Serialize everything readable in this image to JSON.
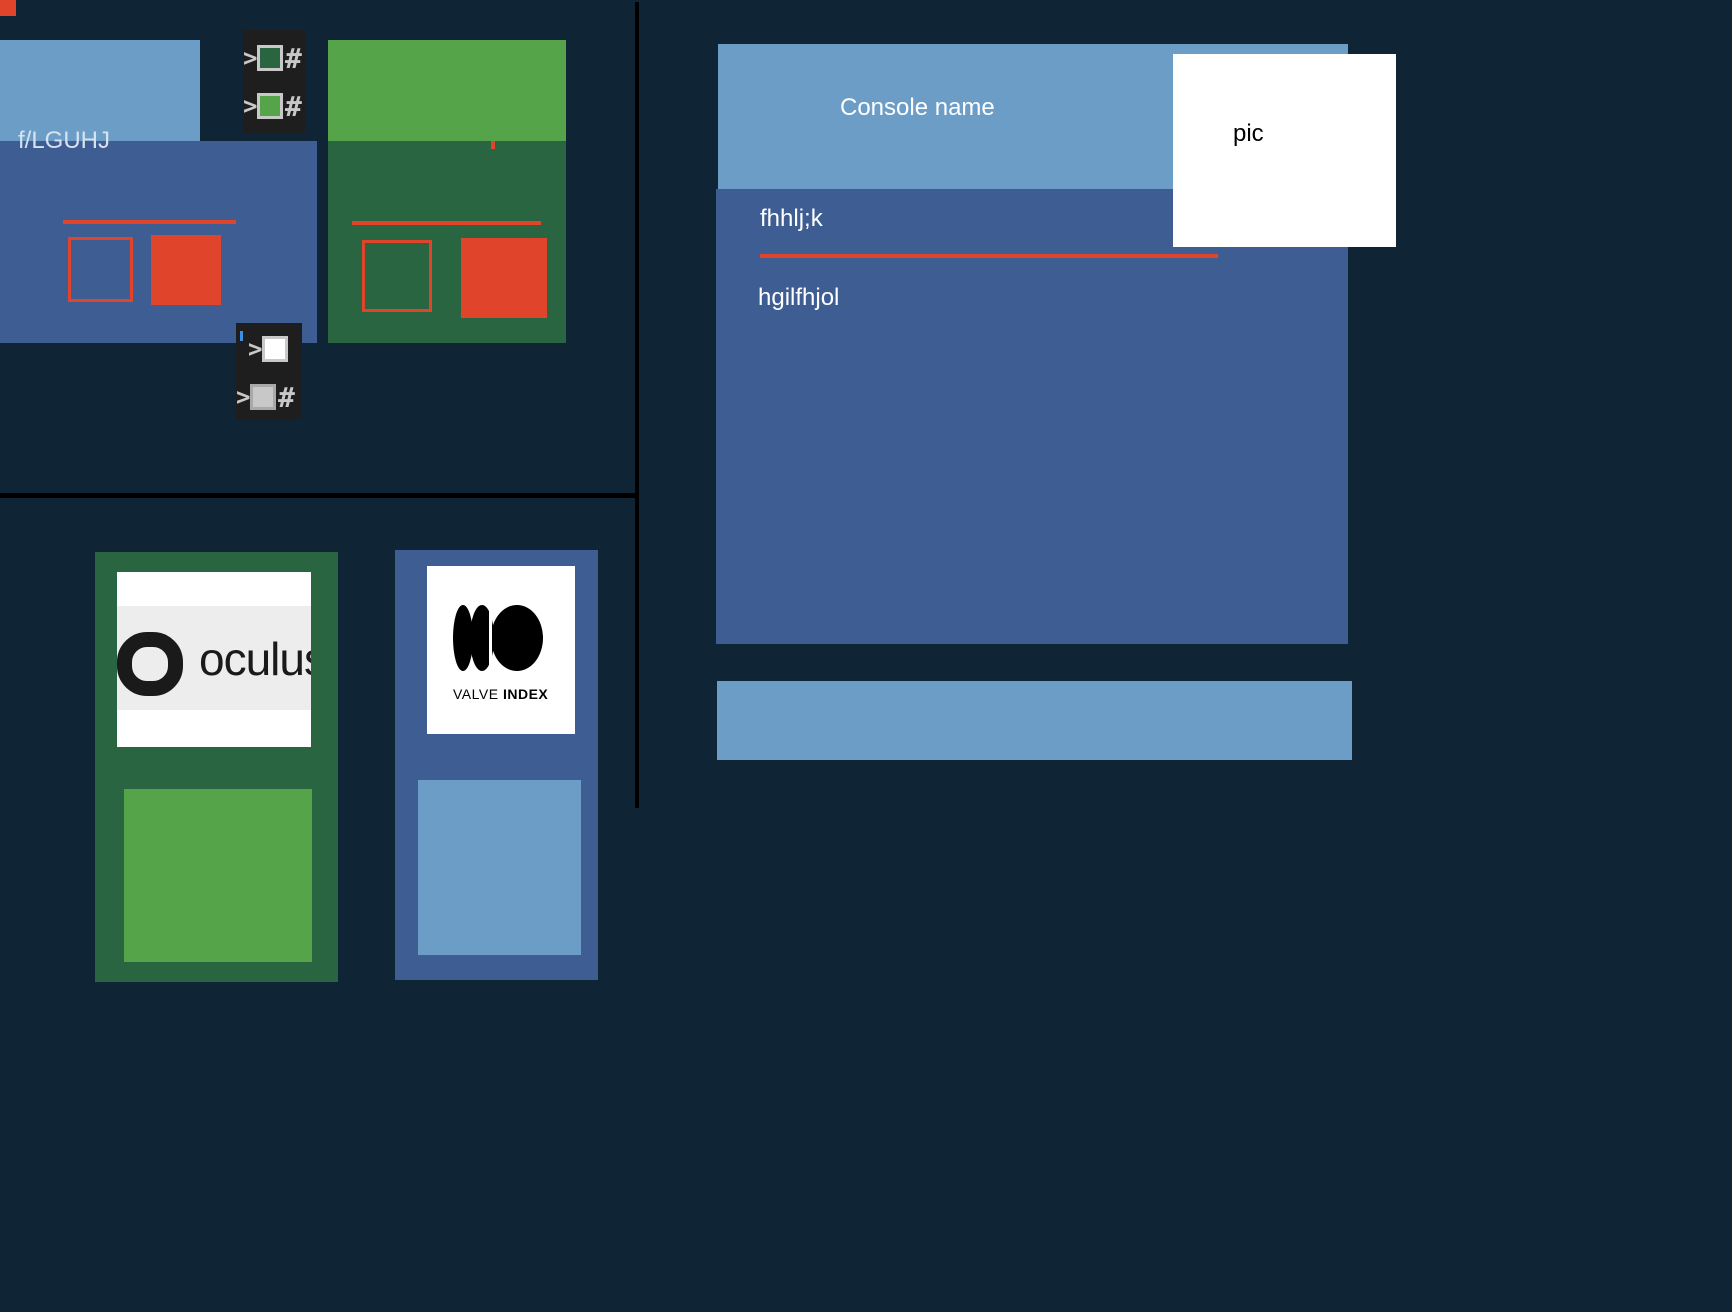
{
  "colors": {
    "background": "#0f2536",
    "light_blue": "#6b9dc7",
    "mid_blue": "#3e5e93",
    "dark_green": "#2a6541",
    "bright_green": "#55a44a",
    "accent_red": "#e0442a",
    "white": "#ffffff",
    "swatch_panel": "#1e1e1e"
  },
  "left_panel": {
    "card_blue": {
      "label": "f/LGUHJ"
    },
    "swatches_top": [
      {
        "icon": "chevron-right-icon",
        "color": "#2a6541",
        "hash": "#"
      },
      {
        "icon": "chevron-right-icon",
        "color": "#55a44a",
        "hash": "#"
      }
    ],
    "swatches_bottom": [
      {
        "icon": "chevron-right-icon",
        "color": "#ffffff",
        "hash": ""
      },
      {
        "icon": "chevron-right-icon",
        "color": "#c8c8c8",
        "hash": "#"
      }
    ]
  },
  "devices": [
    {
      "name": "oculus",
      "logo_text": "oculus",
      "logo_icon": "oculus-logo-icon"
    },
    {
      "name": "valve-index",
      "logo_text_1": "VALVE",
      "logo_text_2": "INDEX",
      "logo_icon": "valve-index-logo-icon"
    }
  ],
  "console_panel": {
    "title": "Console name",
    "pic_label": "pic",
    "field_label": "fhhlj;k",
    "body_text": "hgilfhjol"
  }
}
